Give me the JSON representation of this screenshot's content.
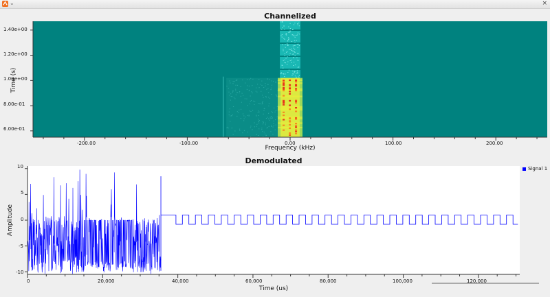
{
  "window": {
    "title": "",
    "close_glyph": "×",
    "menu_glyph": "⌄"
  },
  "colors": {
    "waterfall_bg": "#00827f",
    "signal": "#0000ff",
    "hot": "#ffee44"
  },
  "waterfall": {
    "title": "Channelized",
    "xlabel": "Frequency (kHz)",
    "ylabel": "Time (s)",
    "xticks": [
      "-200.00",
      "-100.00",
      "0.00",
      "100.00",
      "200.00"
    ],
    "yticks": [
      "1.40e+00",
      "1.20e+00",
      "1.00e+00",
      "8.00e-01",
      "6.00e-01"
    ]
  },
  "timeplot": {
    "title": "Demodulated",
    "xlabel": "Time (us)",
    "ylabel": "Amplitude",
    "xticks": [
      "0",
      "20,000",
      "40,000",
      "60,000",
      "80,000",
      "100,000",
      "120,000"
    ],
    "yticks": [
      "10",
      "5",
      "0",
      "-5",
      "-10"
    ],
    "legend": "Signal 1"
  },
  "chart_data": [
    {
      "type": "heatmap",
      "title": "Channelized",
      "xlabel": "Frequency (kHz)",
      "ylabel": "Time (s)",
      "xlim": [
        -250,
        250
      ],
      "ylim": [
        0.55,
        1.47
      ],
      "signal_band_khz": [
        -12,
        12
      ],
      "strong_until_s": 1.02,
      "weak_band_after_s": 1.02
    },
    {
      "type": "line",
      "title": "Demodulated",
      "xlabel": "Time (us)",
      "ylabel": "Amplitude",
      "xlim": [
        0,
        131000
      ],
      "ylim": [
        -10.5,
        10.5
      ],
      "series": [
        {
          "name": "Signal 1",
          "noise_until_us": 35500,
          "square_wave_period_us": 3450,
          "square_wave_high": 1.0,
          "square_wave_low": -0.8
        }
      ]
    }
  ]
}
